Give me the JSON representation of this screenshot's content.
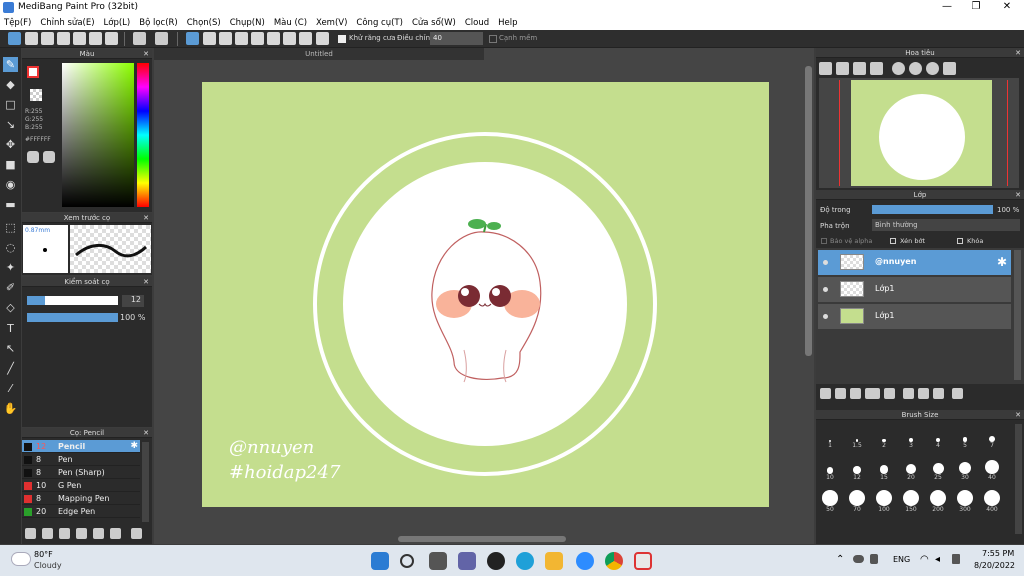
{
  "window": {
    "title": "MediBang Paint Pro (32bit)",
    "min": "—",
    "max": "❐",
    "close": "✕"
  },
  "menu": [
    "Tệp(F)",
    "Chỉnh sửa(E)",
    "Lớp(L)",
    "Bộ lọc(R)",
    "Chọn(S)",
    "Chụp(N)",
    "Màu (C)",
    "Xem(V)",
    "Công cụ(T)",
    "Cửa sổ(W)",
    "Cloud",
    "Help"
  ],
  "toolbar": {
    "antialias_label": "Khử răng cưa",
    "adjust_label": "Điều chỉnh",
    "adjust_value": "40",
    "snap_label": "Cạnh mềm"
  },
  "color_panel": {
    "title": "Màu",
    "r": "R:255",
    "g": "G:255",
    "b": "B:255",
    "hex": "#FFFFFF"
  },
  "brush_preview": {
    "title": "Xem trước cọ",
    "size": "0.87mm"
  },
  "brush_control": {
    "title": "Kiểm soát cọ",
    "size_value": "12",
    "size_fill": 0.2,
    "opacity_value": "100 %",
    "opacity_fill": 1.0
  },
  "brush_list": {
    "title": "Cọ: Pencil",
    "items": [
      {
        "size": "12",
        "name": "Pencil",
        "color": "#111111"
      },
      {
        "size": "8",
        "name": "Pen",
        "color": "#111111"
      },
      {
        "size": "8",
        "name": "Pen (Sharp)",
        "color": "#111111"
      },
      {
        "size": "10",
        "name": "G Pen",
        "color": "#e03030"
      },
      {
        "size": "8",
        "name": "Mapping Pen",
        "color": "#e03030"
      },
      {
        "size": "20",
        "name": "Edge Pen",
        "color": "#2aa02a"
      }
    ]
  },
  "document": {
    "title": "Untitled"
  },
  "artwork": {
    "watermark_line1": "@nnuyen",
    "watermark_line2": "#hoidap247"
  },
  "navigator": {
    "title": "Hoa tiêu"
  },
  "layer_panel": {
    "title": "Lớp",
    "opacity_label": "Độ trong",
    "opacity_value": "100 %",
    "blend_label": "Pha trộn",
    "blend_value": "Bình thường",
    "protect_alpha": "Bảo vệ alpha",
    "clipping": "Xén bớt",
    "lock": "Khóa",
    "layers": [
      {
        "name": "@nnuyen"
      },
      {
        "name": "Lớp1"
      },
      {
        "name": "Lớp1"
      }
    ]
  },
  "brush_size": {
    "title": "Brush Size",
    "sizes": [
      "1",
      "1.5",
      "2",
      "3",
      "4",
      "5",
      "7",
      "10",
      "12",
      "15",
      "20",
      "25",
      "30",
      "40",
      "50",
      "70",
      "100",
      "150",
      "200",
      "300",
      "400"
    ]
  },
  "taskbar": {
    "temp": "80°F",
    "weather": "Cloudy",
    "lang": "ENG",
    "time": "7:55 PM",
    "date": "8/20/2022"
  }
}
